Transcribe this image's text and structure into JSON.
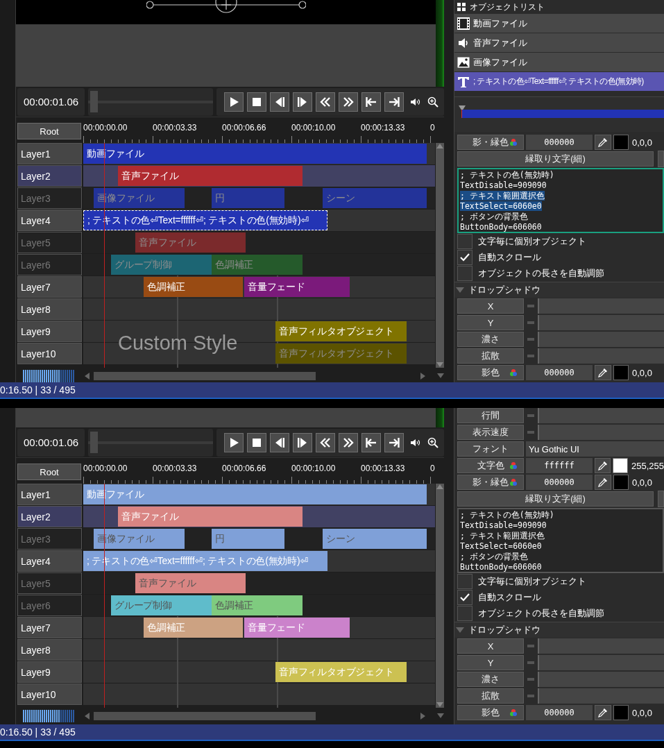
{
  "panels": [
    {
      "canvas_shown": true,
      "time": "00:00:01.06",
      "root_label": "Root",
      "ruler": [
        "00:00:00.00",
        "00:00:03.33",
        "00:00:06.66",
        "00:00:10.00",
        "00:00:13.33",
        "0"
      ],
      "layers": [
        {
          "name": "Layer1",
          "selected": false,
          "enabled": true,
          "clips": [
            {
              "label": "動画ファイル",
              "color": "#2334b4",
              "enabled": true,
              "selected": false
            }
          ]
        },
        {
          "name": "Layer2",
          "selected": true,
          "enabled": true,
          "clips": [
            {
              "label": "音声ファイル",
              "color": "#b02b30",
              "enabled": true,
              "selected": false
            }
          ]
        },
        {
          "name": "Layer3",
          "selected": false,
          "enabled": false,
          "clips": [
            {
              "label": "画像ファイル",
              "color": "#233399",
              "enabled": false,
              "selected": false
            },
            {
              "label": "円",
              "color": "#233399",
              "enabled": false,
              "selected": false
            },
            {
              "label": "シーン",
              "color": "#233399",
              "enabled": false,
              "selected": false
            }
          ]
        },
        {
          "name": "Layer4",
          "selected": false,
          "enabled": true,
          "clips": [
            {
              "label": "; テキストの色⏎Text=ffffff⏎; テキストの色(無効時)⏎",
              "color": "#2334b4",
              "enabled": true,
              "selected": true
            }
          ]
        },
        {
          "name": "Layer5",
          "selected": false,
          "enabled": false,
          "clips": [
            {
              "label": "音声ファイル",
              "color": "#7b2a2c",
              "enabled": false,
              "selected": false
            }
          ]
        },
        {
          "name": "Layer6",
          "selected": false,
          "enabled": false,
          "clips": [
            {
              "label": "グループ制御",
              "color": "#1c6573",
              "enabled": false,
              "selected": false
            },
            {
              "label": "色調補正",
              "color": "#255a2b",
              "enabled": false,
              "selected": false
            }
          ]
        },
        {
          "name": "Layer7",
          "selected": false,
          "enabled": true,
          "clips": [
            {
              "label": "色調補正",
              "color": "#994b13",
              "enabled": true,
              "selected": false
            },
            {
              "label": "音量フェード",
              "color": "#7b1a7b",
              "enabled": true,
              "selected": false
            }
          ]
        },
        {
          "name": "Layer8",
          "selected": false,
          "enabled": true
        },
        {
          "name": "Layer9",
          "selected": false,
          "enabled": true,
          "clips": [
            {
              "label": "音声フィルタオブジェクト",
              "color": "#807300",
              "enabled": true,
              "selected": false
            }
          ]
        },
        {
          "name": "Layer10",
          "selected": false,
          "enabled": true,
          "clips": [
            {
              "label": "音声フィルタオブジェクト",
              "color": "#5c5300",
              "enabled": false,
              "selected": false
            }
          ]
        }
      ],
      "overlay_text": "Custom Style",
      "status": "0:16.50 | 33 / 495",
      "object_list": {
        "title": "オブジェクトリスト",
        "items": [
          {
            "kind": "video",
            "label": "動画ファイル",
            "selected": false
          },
          {
            "kind": "audio",
            "label": "音声ファイル",
            "selected": false
          },
          {
            "kind": "image",
            "label": "画像ファイル",
            "selected": false
          },
          {
            "kind": "text",
            "label": "; テキストの色⏎Text=ffffff⏎; テキストの色(無効時)",
            "selected": true
          }
        ]
      },
      "mini_timeline": true,
      "properties": [
        {
          "kind": "color",
          "label": "影・縁色",
          "hex": "000000",
          "color": "#000000",
          "rgb": "0,0,0"
        },
        {
          "kind": "button",
          "label": "縁取り文字(細)"
        },
        {
          "kind": "textarea",
          "focused": true,
          "lines": [
            {
              "text": "; テキストの色(無効時)",
              "selected": false
            },
            {
              "text": "TextDisable=909090",
              "selected": false
            },
            {
              "text": "; テキスト範囲選択色",
              "selected": true
            },
            {
              "text": "TextSelect=6060e0",
              "selected": true
            },
            {
              "text": "; ボタンの背景色",
              "selected": false
            },
            {
              "text": "ButtonBody=606060",
              "selected": false
            }
          ]
        },
        {
          "kind": "checkbox",
          "label": "文字毎に個別オブジェクト",
          "checked": false
        },
        {
          "kind": "checkbox",
          "label": "自動スクロール",
          "checked": true
        },
        {
          "kind": "checkbox",
          "label": "オブジェクトの長さを自動調節",
          "checked": false
        },
        {
          "kind": "section",
          "label": "ドロップシャドウ",
          "expanded": true
        },
        {
          "kind": "slider",
          "label": "X"
        },
        {
          "kind": "slider",
          "label": "Y"
        },
        {
          "kind": "slider",
          "label": "濃さ"
        },
        {
          "kind": "slider",
          "label": "拡散"
        },
        {
          "kind": "color",
          "label": "影色",
          "hex": "000000",
          "color": "#000000",
          "rgb": "0,0,0"
        }
      ]
    },
    {
      "canvas_shown": false,
      "time": "00:00:01.06",
      "root_label": "Root",
      "ruler": [
        "00:00:00.00",
        "00:00:03.33",
        "00:00:06.66",
        "00:00:10.00",
        "00:00:13.33",
        "0"
      ],
      "layers": [
        {
          "name": "Layer1",
          "selected": false,
          "enabled": true,
          "clips": [
            {
              "label": "動画ファイル",
              "color": "#7fa0d8",
              "enabled": true,
              "selected": false
            }
          ]
        },
        {
          "name": "Layer2",
          "selected": true,
          "enabled": true,
          "clips": [
            {
              "label": "音声ファイル",
              "color": "#d98583",
              "enabled": true,
              "selected": false
            }
          ]
        },
        {
          "name": "Layer3",
          "selected": false,
          "enabled": false,
          "clips": [
            {
              "label": "画像ファイル",
              "color": "#7fa0d8",
              "enabled": false,
              "selected": false
            },
            {
              "label": "円",
              "color": "#7fa0d8",
              "enabled": false,
              "selected": false
            },
            {
              "label": "シーン",
              "color": "#7fa0d8",
              "enabled": false,
              "selected": false
            }
          ]
        },
        {
          "name": "Layer4",
          "selected": false,
          "enabled": true,
          "clips": [
            {
              "label": "; テキストの色⏎Text=ffffff⏎; テキストの色(無効時)⏎",
              "color": "#7fa0d8",
              "enabled": true,
              "selected": false
            }
          ]
        },
        {
          "name": "Layer5",
          "selected": false,
          "enabled": false,
          "clips": [
            {
              "label": "音声ファイル",
              "color": "#d98583",
              "enabled": false,
              "selected": false
            }
          ]
        },
        {
          "name": "Layer6",
          "selected": false,
          "enabled": false,
          "clips": [
            {
              "label": "グループ制御",
              "color": "#5fbccb",
              "enabled": false,
              "selected": false
            },
            {
              "label": "色調補正",
              "color": "#7fcb7f",
              "enabled": false,
              "selected": false
            }
          ]
        },
        {
          "name": "Layer7",
          "selected": false,
          "enabled": true,
          "clips": [
            {
              "label": "色調補正",
              "color": "#cca282",
              "enabled": true,
              "selected": false
            },
            {
              "label": "音量フェード",
              "color": "#cb82cb",
              "enabled": true,
              "selected": false
            }
          ]
        },
        {
          "name": "Layer8",
          "selected": false,
          "enabled": true
        },
        {
          "name": "Layer9",
          "selected": false,
          "enabled": true,
          "clips": [
            {
              "label": "音声フィルタオブジェクト",
              "color": "#ccc152",
              "enabled": true,
              "selected": false
            }
          ]
        },
        {
          "name": "Layer10",
          "selected": false,
          "enabled": true
        }
      ],
      "status": "0:16.50 | 33 / 495",
      "properties": [
        {
          "kind": "slider",
          "label": "行間"
        },
        {
          "kind": "slider",
          "label": "表示速度"
        },
        {
          "kind": "font",
          "label": "フォント",
          "value": "Yu Gothic UI"
        },
        {
          "kind": "color",
          "label": "文字色",
          "hex": "ffffff",
          "color": "#ffffff",
          "rgb": "255,255"
        },
        {
          "kind": "color",
          "label": "影・縁色",
          "hex": "000000",
          "color": "#000000",
          "rgb": "0,0,0"
        },
        {
          "kind": "button",
          "label": "縁取り文字(細)"
        },
        {
          "kind": "textarea",
          "focused": false,
          "lines": [
            {
              "text": "; テキストの色(無効時)",
              "selected": false
            },
            {
              "text": "TextDisable=909090",
              "selected": false
            },
            {
              "text": "; テキスト範囲選択色",
              "selected": false
            },
            {
              "text": "TextSelect=6060e0",
              "selected": false
            },
            {
              "text": "; ボタンの背景色",
              "selected": false
            },
            {
              "text": "ButtonBody=606060",
              "selected": false
            }
          ]
        },
        {
          "kind": "checkbox",
          "label": "文字毎に個別オブジェクト",
          "checked": false
        },
        {
          "kind": "checkbox",
          "label": "自動スクロール",
          "checked": true
        },
        {
          "kind": "checkbox",
          "label": "オブジェクトの長さを自動調節",
          "checked": false
        },
        {
          "kind": "section",
          "label": "ドロップシャドウ",
          "expanded": true
        },
        {
          "kind": "slider",
          "label": "X"
        },
        {
          "kind": "slider",
          "label": "Y"
        },
        {
          "kind": "slider",
          "label": "濃さ"
        },
        {
          "kind": "slider",
          "label": "拡散"
        },
        {
          "kind": "color",
          "label": "影色",
          "hex": "000000",
          "color": "#000000",
          "rgb": "0,0,0"
        }
      ]
    }
  ]
}
